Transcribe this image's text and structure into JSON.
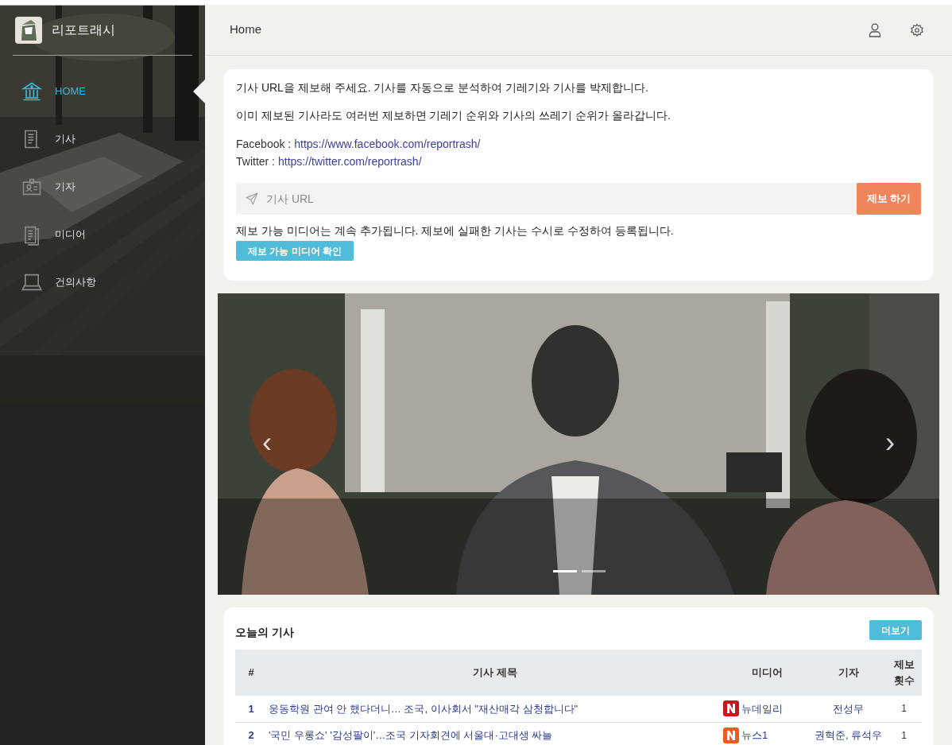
{
  "sidebar": {
    "brand": "리포트래시",
    "items": [
      {
        "label": "HOME",
        "kind": "bank",
        "selected": true
      },
      {
        "label": "기사",
        "kind": "doc",
        "selected": false
      },
      {
        "label": "기자",
        "kind": "badge",
        "selected": false
      },
      {
        "label": "미디어",
        "kind": "docs",
        "selected": false
      },
      {
        "label": "건의사항",
        "kind": "laptop",
        "selected": false
      }
    ]
  },
  "header": {
    "title": "Home"
  },
  "report_card": {
    "paragraphs": [
      "기사 URL을 제보해 주세요. 기사를 자동으로 분석하여 기레기와 기사를 박제합니다.",
      "이미 제보된 기사라도 여러번 제보하면 기레기 순위와 기사의 쓰레기 순위가 올라갑니다."
    ],
    "links": [
      {
        "label": "Facebook :",
        "url": "https://www.facebook.com/reportrash/"
      },
      {
        "label": "Twitter :",
        "url": "https://twitter.com/reportrash/"
      }
    ],
    "url_field": {
      "placeholder": "기사 URL"
    },
    "submit": "제보 하기",
    "note": "제보 가능 미디어는 계속 추가됩니다. 제보에 실패한 기사는 수시로 수정하여 등록됩니다.",
    "media_button": "제보 가능 미디어 확인"
  },
  "carousel": {
    "prev": "‹",
    "next": "›",
    "slides": [
      {
        "selected": true
      },
      {
        "selected": false
      }
    ]
  },
  "today": {
    "title": "오늘의 기사",
    "more": "더보기",
    "columns": [
      "#",
      "기사 제목",
      "미디어",
      "기자",
      "제보 횟수"
    ],
    "rows": [
      {
        "rank": "1",
        "title": "웅동학원 관여 안 했다더니… 조국, 이사회서 \"재산매각 삼청합니다\"",
        "media": "뉴데일리",
        "color": "#c8161d",
        "reporter": "전성무",
        "count": "1"
      },
      {
        "rank": "2",
        "title": "'국민 우롱쇼' '감성팔이'…조국 기자회견에 서울대·고대생 싸늘",
        "media": "뉴스1",
        "color": "#f15a22",
        "reporter": "권혁준, 류석우",
        "count": "1"
      }
    ]
  }
}
